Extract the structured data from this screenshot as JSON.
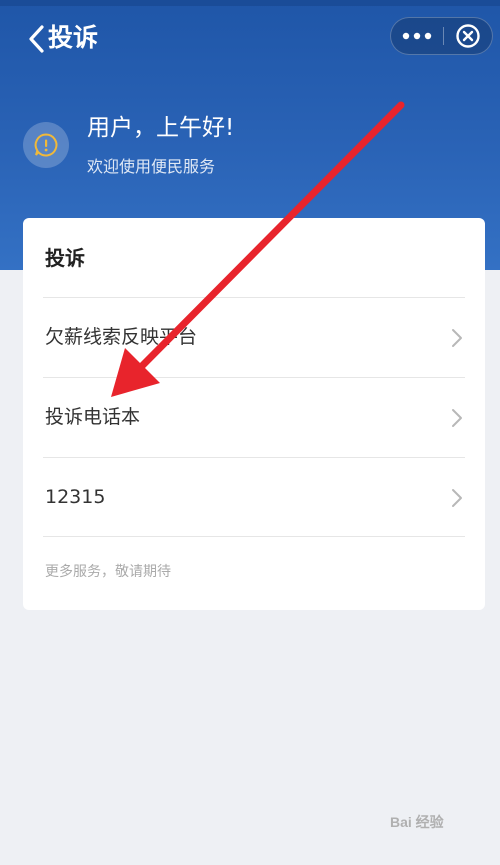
{
  "nav": {
    "title": "投诉"
  },
  "header": {
    "greeting": "用户，上午好!",
    "welcome": "欢迎使用便民服务"
  },
  "card": {
    "title": "投诉",
    "items": [
      {
        "label": "欠薪线索反映平台"
      },
      {
        "label": "投诉电话本"
      },
      {
        "label": "12315"
      }
    ],
    "more": "更多服务，敬请期待"
  },
  "watermark": "Bai 经验",
  "colors": {
    "header_top": "#1f56a8",
    "header_bottom": "#3471c4",
    "annotation": "#e8242c",
    "avatar_icon": "#f0b93a"
  },
  "icons": [
    "back-arrow-icon",
    "more-dots-icon",
    "close-circle-icon",
    "notice-icon",
    "chevron-right-icon"
  ]
}
